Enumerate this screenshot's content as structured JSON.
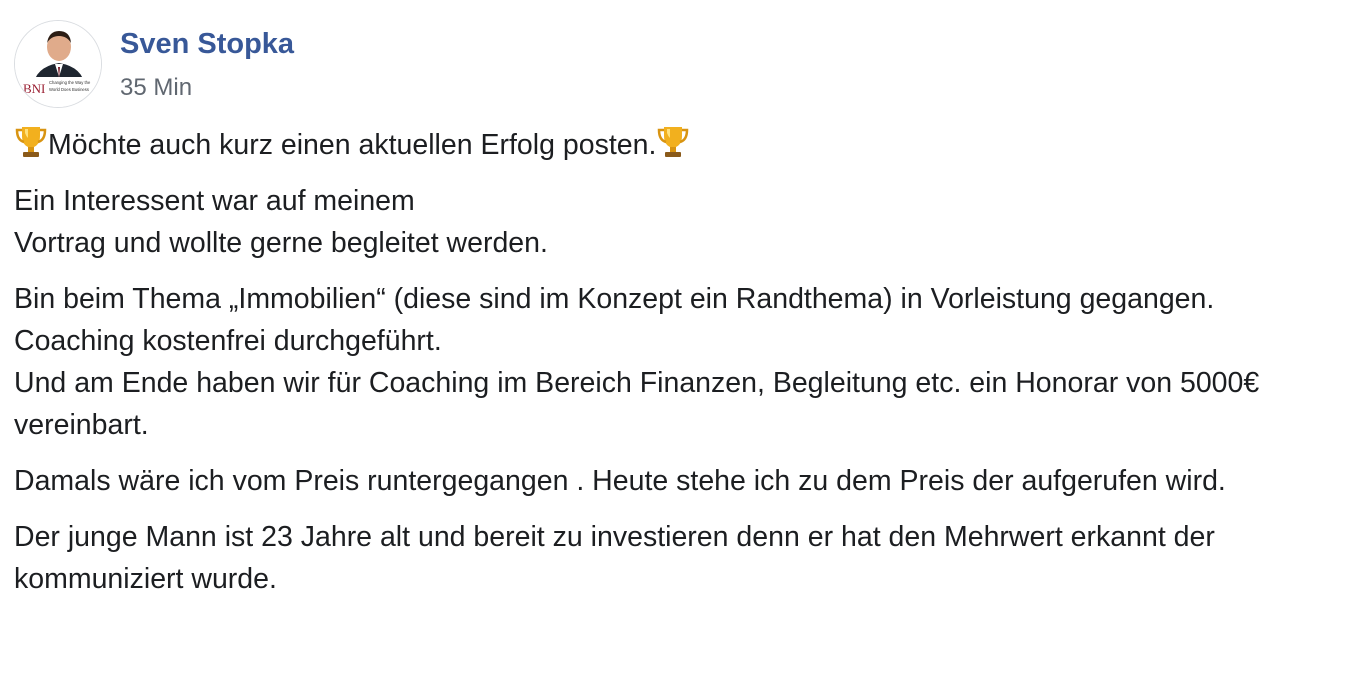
{
  "post": {
    "author": {
      "name": "Sven Stopka",
      "avatar_badge_text": "BNI",
      "avatar_tagline": "Changing the Way the World Does Business"
    },
    "timestamp": "35 Min",
    "headline": {
      "leading_icon": "trophy-icon",
      "text": "Möchte auch kurz einen aktuellen Erfolg posten.",
      "trailing_icon": "trophy-icon"
    },
    "paragraphs": [
      [
        "Ein Interessent war auf meinem",
        "Vortrag und wollte gerne begleitet werden."
      ],
      [
        "Bin beim Thema „Immobilien“ (diese sind im Konzept ein Randthema) in Vorleistung gegangen.",
        "Coaching kostenfrei durchgeführt.",
        "Und am Ende haben wir für Coaching im Bereich Finanzen, Begleitung etc. ein Honorar von 5000€ vereinbart."
      ],
      [
        "Damals wäre ich vom Preis runtergegangen . Heute stehe ich zu dem Preis der aufgerufen wird."
      ],
      [
        "Der junge Mann ist 23 Jahre alt und bereit zu investieren denn er hat den Mehrwert erkannt der kommuniziert wurde."
      ]
    ]
  },
  "colors": {
    "author_link": "#385898",
    "meta_text": "#606770",
    "body_text": "#1c1e21",
    "trophy_gold": "#f2b01e"
  }
}
